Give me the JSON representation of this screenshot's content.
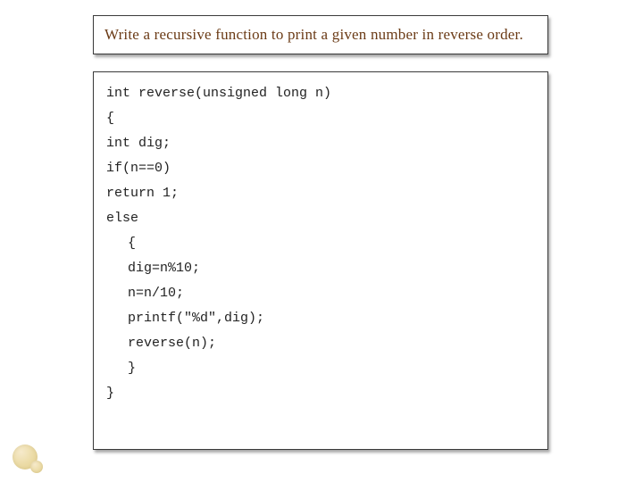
{
  "title": "Write a recursive function to print a given number in reverse order.",
  "code": {
    "l0": "int reverse(unsigned long n)",
    "l1": "{",
    "l2": "int dig;",
    "l3": "if(n==0)",
    "l4": "return 1;",
    "l5": "else",
    "l6": "{",
    "l7": "dig=n%10;",
    "l8": "n=n/10;",
    "l9": "printf(\"%d\",dig);",
    "l10": "reverse(n);",
    "l11": "}",
    "l12": "}"
  }
}
